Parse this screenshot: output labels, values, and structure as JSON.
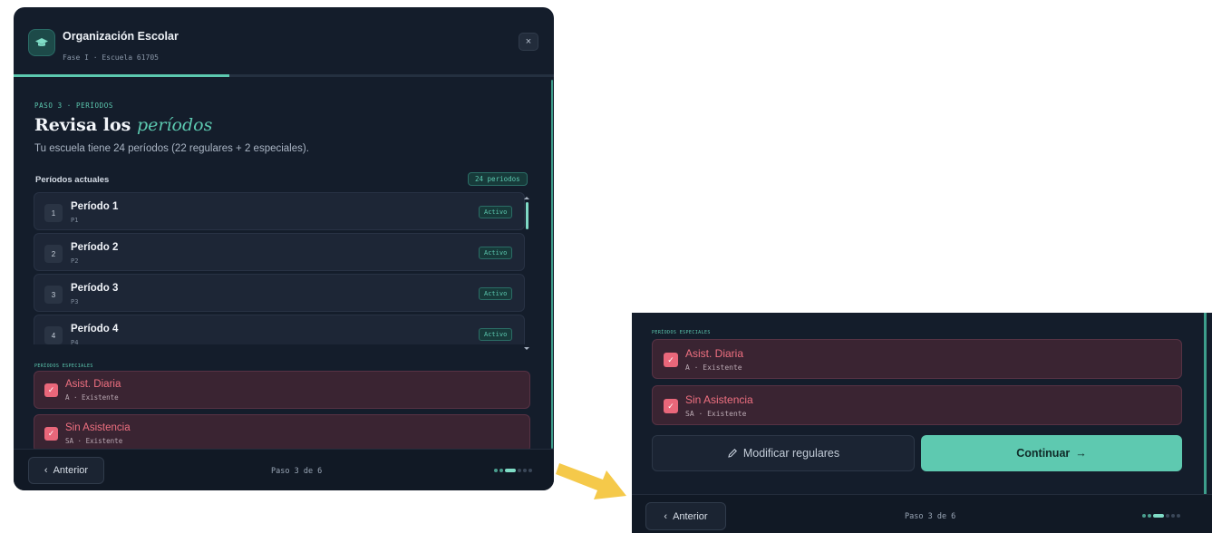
{
  "modal": {
    "title": "Organización Escolar",
    "subtitle": "Fase I · Escuela 61705",
    "close_icon": "×",
    "step_label": "PASO 3 · PERÍODOS",
    "heading_main": "Revisa los ",
    "heading_accent": "períodos",
    "description": "Tu escuela tiene 24 períodos (22 regulares + 2 especiales).",
    "list_title": "Períodos actuales",
    "count_badge": "24 periodos",
    "progress_fraction": 0.4,
    "periods": [
      {
        "num": "1",
        "name": "Período 1",
        "code": "P1",
        "status": "Activo"
      },
      {
        "num": "2",
        "name": "Período 2",
        "code": "P2",
        "status": "Activo"
      },
      {
        "num": "3",
        "name": "Período 3",
        "code": "P3",
        "status": "Activo"
      },
      {
        "num": "4",
        "name": "Período 4",
        "code": "P4",
        "status": "Activo"
      }
    ],
    "special_label": "PERÍODOS ESPECIALES",
    "special": [
      {
        "name": "Asist. Diaria",
        "code": "A · Existente",
        "checked": true
      },
      {
        "name": "Sin Asistencia",
        "code": "SA · Existente",
        "checked": true
      }
    ],
    "footer": {
      "prev_label": "Anterior",
      "step_counter": "Paso 3 de 6",
      "total_steps": 6,
      "current_step": 3
    }
  },
  "panel2": {
    "special_label": "PERÍODOS ESPECIALES",
    "special": [
      {
        "name": "Asist. Diaria",
        "code": "A · Existente",
        "checked": true
      },
      {
        "name": "Sin Asistencia",
        "code": "SA · Existente",
        "checked": true
      }
    ],
    "modify_label": "Modificar regulares",
    "continue_label": "Continuar",
    "footer": {
      "prev_label": "Anterior",
      "step_counter": "Paso 3 de 6",
      "total_steps": 6,
      "current_step": 3
    }
  },
  "colors": {
    "accent": "#5cc9b0",
    "background": "#141d2b",
    "special_text": "#ef7080",
    "arrow": "#f5c94a"
  },
  "icons": {
    "logo": "graduation-cap-icon",
    "close": "close-icon",
    "check": "check-icon",
    "prev": "chevron-left-icon",
    "modify": "pencil-icon",
    "continue": "arrow-right-icon"
  }
}
